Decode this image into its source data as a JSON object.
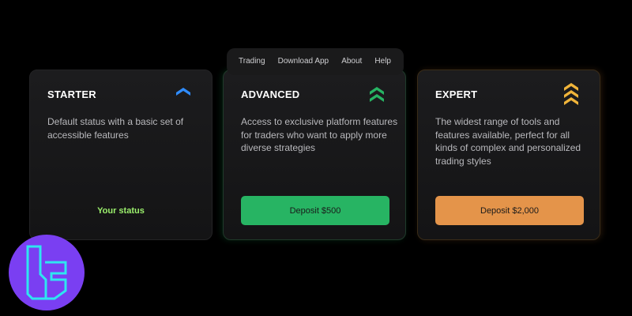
{
  "nav": {
    "items": [
      "Trading",
      "Download App",
      "About",
      "Help"
    ]
  },
  "cards": {
    "starter": {
      "title": "STARTER",
      "description": "Default status with a basic set of accessible features",
      "status": "Your status",
      "icon": "single-chevron-up-icon",
      "accent": "#2f8cff"
    },
    "advanced": {
      "title": "ADVANCED",
      "description": "Access to exclusive platform features for traders who want to apply more diverse strategies",
      "button": "Deposit $500",
      "icon": "double-chevron-up-icon",
      "accent": "#27b463"
    },
    "expert": {
      "title": "EXPERT",
      "description": "The widest range of tools and features available, perfect for all kinds of complex and personalized trading styles",
      "button": "Deposit $2,000",
      "icon": "triple-chevron-up-icon",
      "accent": "#f0b43a"
    }
  },
  "colors": {
    "background": "#000000",
    "card": "#1a1a1b",
    "status_green": "#9cf16d",
    "button_orange": "#e4944a",
    "logo_purple": "#7a3ff2",
    "logo_cyan": "#2ee6f0"
  },
  "logo": {
    "icon": "brand-logo-icon"
  }
}
